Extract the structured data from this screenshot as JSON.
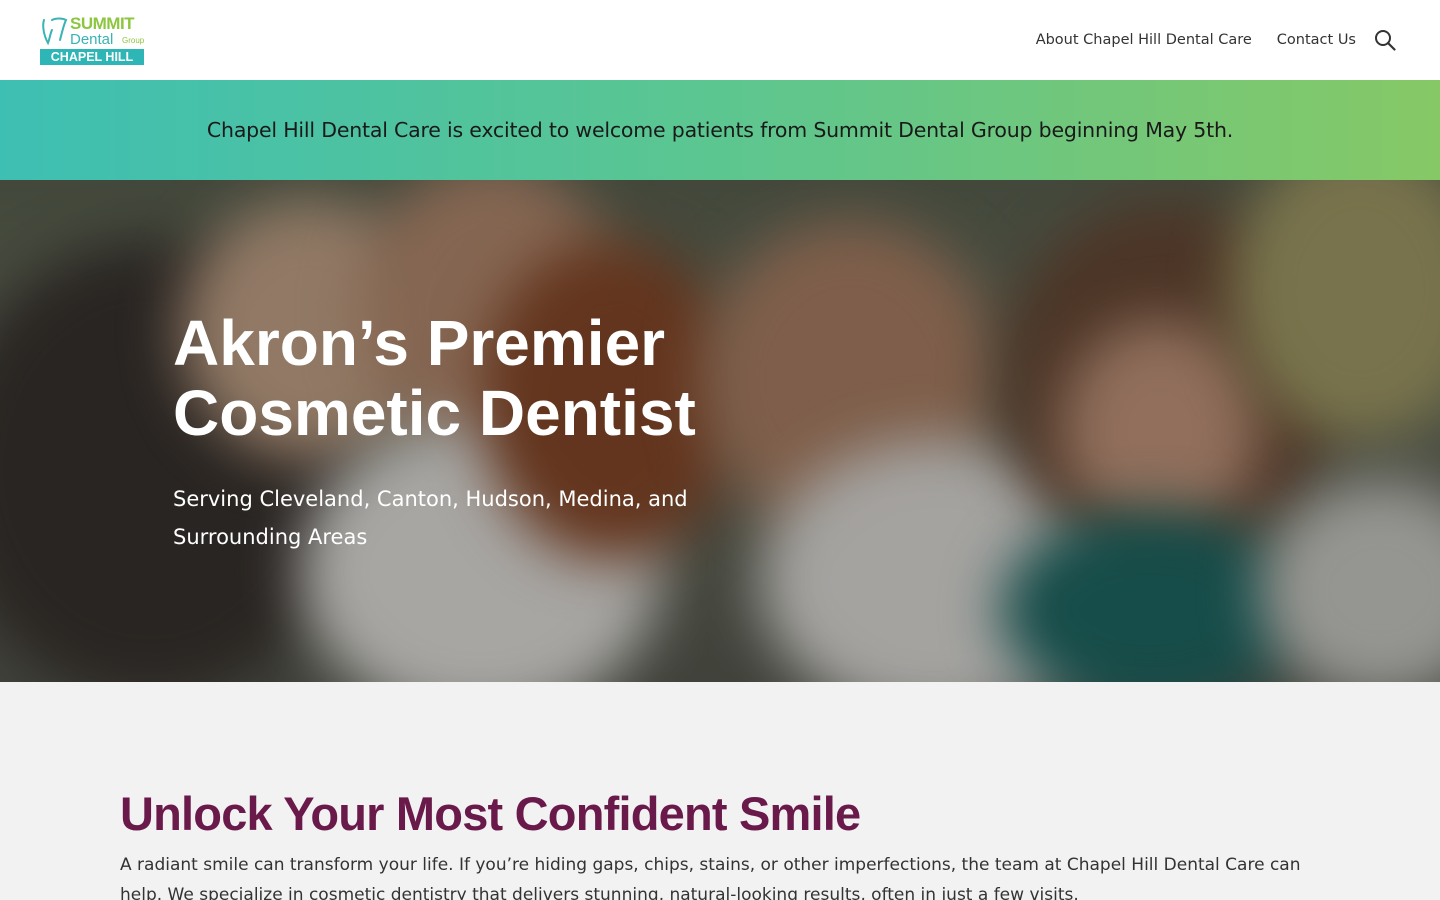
{
  "header": {
    "logo": {
      "summit": "SUMMIT",
      "dental": "Dental",
      "group": "Group",
      "location": "CHAPEL HILL"
    },
    "nav": [
      {
        "label": "About Chapel Hill Dental Care"
      },
      {
        "label": "Contact Us"
      }
    ],
    "search_icon": "search-icon"
  },
  "announcement": {
    "text": "Chapel Hill Dental Care is excited to welcome patients from Summit Dental Group beginning May 5th."
  },
  "hero": {
    "title": "Akron’s Premier Cosmetic Dentist",
    "subtitle": "Serving Cleveland, Canton, Hudson, Medina, and Surrounding Areas"
  },
  "intro": {
    "heading": "Unlock Your Most Confident Smile",
    "body": "A radiant smile can transform your life. If you’re hiding gaps, chips, stains, or other imperfections, the team at Chapel Hill Dental Care can help. We specialize in cosmetic dentistry that delivers stunning, natural-looking results, often in just a few visits."
  },
  "colors": {
    "accent_teal": "#2eb5b5",
    "accent_green": "#8cc63f",
    "heading_plum": "#6a1a4a"
  }
}
